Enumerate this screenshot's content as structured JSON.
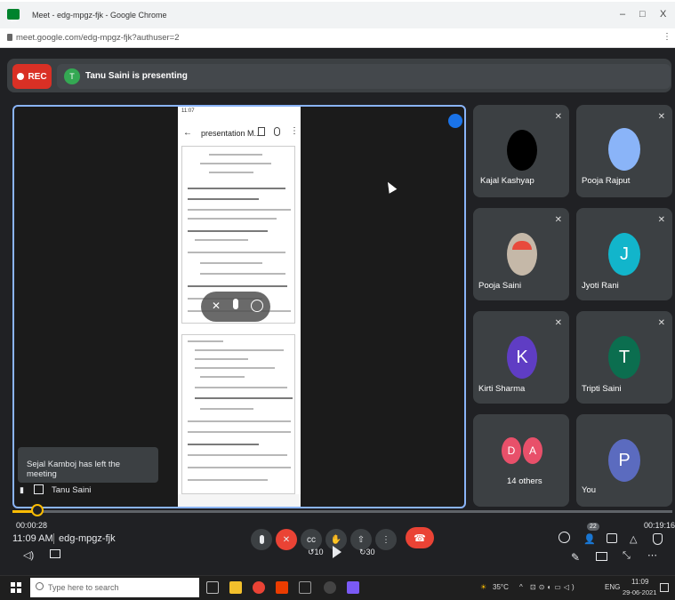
{
  "window": {
    "title": "Meet - edg-mpgz-fjk - Google Chrome",
    "minimize": "–",
    "maximize": "□",
    "close": "X"
  },
  "browser": {
    "url": "meet.google.com/edg-mpgz-fjk?authuser=2"
  },
  "banner": {
    "rec_label": "REC",
    "presenter_initial": "T",
    "presenting_text": "Tanu Saini is presenting"
  },
  "stage": {
    "phone_status": "11:07",
    "phone_title": "presentation M...",
    "toast": "Sejal Kamboj has left the meeting",
    "presenter_name": "Tanu Saini"
  },
  "participants": [
    {
      "name": "Kajal Kashyap",
      "initial": "",
      "color": "#000000"
    },
    {
      "name": "Pooja Rajput",
      "initial": "",
      "color": "#8ab4f8"
    },
    {
      "name": "Pooja Saini",
      "initial": "",
      "color": "#c5b8a8"
    },
    {
      "name": "Jyoti Rani",
      "initial": "J",
      "color": "#12b5cb"
    },
    {
      "name": "Kirti Sharma",
      "initial": "K",
      "color": "#5f3dc4"
    },
    {
      "name": "Tripti Saini",
      "initial": "T",
      "color": "#0b6e4f"
    },
    {
      "name": "14 others",
      "initial_a": "D",
      "initial_b": "A",
      "color": "#e8506a"
    },
    {
      "name": "You",
      "initial": "P",
      "color": "#5b6bbf"
    }
  ],
  "player": {
    "elapsed": "00:00:28",
    "total": "00:19:16",
    "skip_back": "10",
    "skip_fwd": "30",
    "progress": 0.024
  },
  "meeting": {
    "time": "11:09 AM",
    "code": "edg-mpgz-fjk",
    "participants_badge": "22"
  },
  "taskbar": {
    "search_placeholder": "Type here to search",
    "temperature": "35°C",
    "lang": "ENG",
    "clock": "11:09",
    "date": "29-06-2021"
  }
}
